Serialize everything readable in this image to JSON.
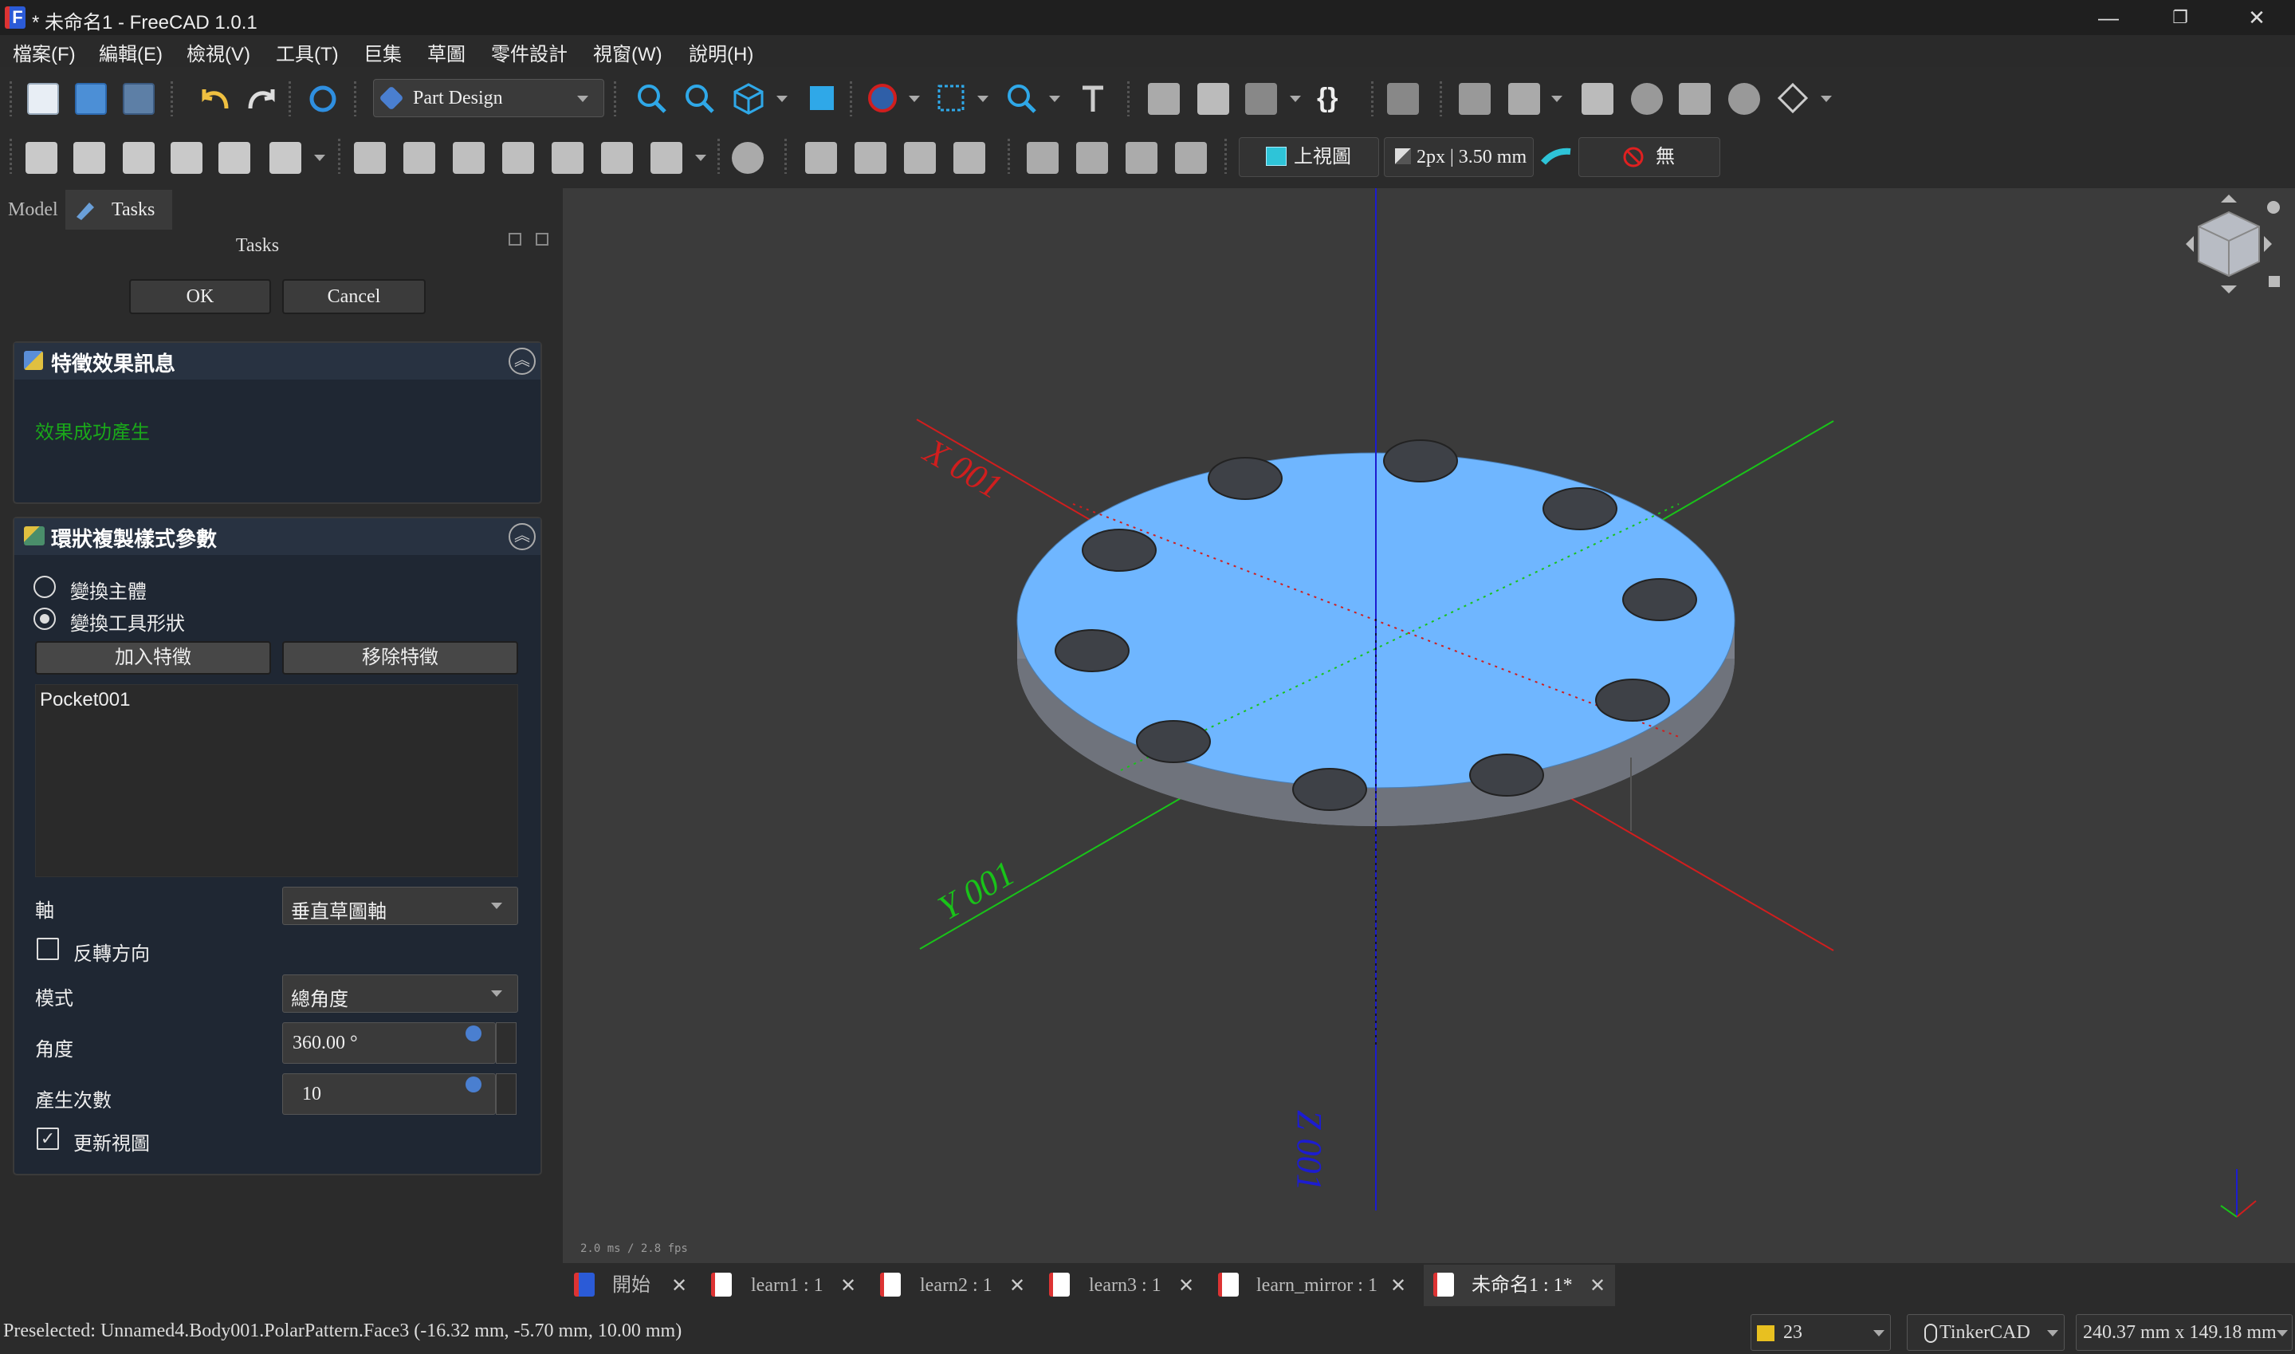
{
  "window": {
    "title": "* 未命名1 - FreeCAD 1.0.1",
    "logo": "F",
    "minimize": "—",
    "restore": "❐",
    "close": "✕"
  },
  "menu": [
    "檔案(F)",
    "編輯(E)",
    "檢視(V)",
    "工具(T)",
    "巨集",
    "草圖",
    "零件設計",
    "視窗(W)",
    "說明(H)"
  ],
  "toolbar": {
    "workbench": "Part Design",
    "view_label": "上視圖",
    "line_label": "2px | 3.50 mm",
    "none_label": "無"
  },
  "left_panel": {
    "tab_model": "Model",
    "tab_tasks": "Tasks",
    "header": "Tasks",
    "ok": "OK",
    "cancel": "Cancel",
    "info_box": {
      "title": "特徵效果訊息",
      "message": "效果成功產生"
    },
    "params_box": {
      "title": "環狀複製樣式參數",
      "radio_base": "變換主體",
      "radio_tool": "變換工具形狀",
      "add_feature": "加入特徵",
      "remove_feature": "移除特徵",
      "features": [
        "Pocket001"
      ],
      "axis_label": "軸",
      "axis_value": "垂直草圖軸",
      "reverse_label": "反轉方向",
      "mode_label": "模式",
      "mode_value": "總角度",
      "angle_label": "角度",
      "angle_value": "360.00 °",
      "occurrences_label": "產生次數",
      "occurrences_value": "10",
      "update_view_label": "更新視圖"
    }
  },
  "viewport": {
    "x_axis_label": "X 001",
    "y_axis_label": "Y 001",
    "z_axis_label": "Z 001",
    "fps_text": "2.0 ms / 2.8 fps",
    "colors": {
      "part_top": "#6fb6ff",
      "part_side": "#7b7f89",
      "x_axis": "#d01e1e",
      "y_axis": "#19c319",
      "z_axis": "#1c1cd0"
    }
  },
  "doc_tabs": [
    {
      "label": "開始",
      "active": false
    },
    {
      "label": "learn1 : 1",
      "active": false
    },
    {
      "label": "learn2 : 1",
      "active": false
    },
    {
      "label": "learn3 : 1",
      "active": false
    },
    {
      "label": "learn_mirror : 1",
      "active": false
    },
    {
      "label": "未命名1 : 1*",
      "active": true
    }
  ],
  "statusbar": {
    "message": "Preselected: Unnamed4.Body001.PolarPattern.Face3 (-16.32 mm, -5.70 mm, 10.00 mm)",
    "layer_count": "23",
    "nav_style": "TinkerCAD",
    "dimensions": "240.37 mm x 149.18 mm"
  }
}
